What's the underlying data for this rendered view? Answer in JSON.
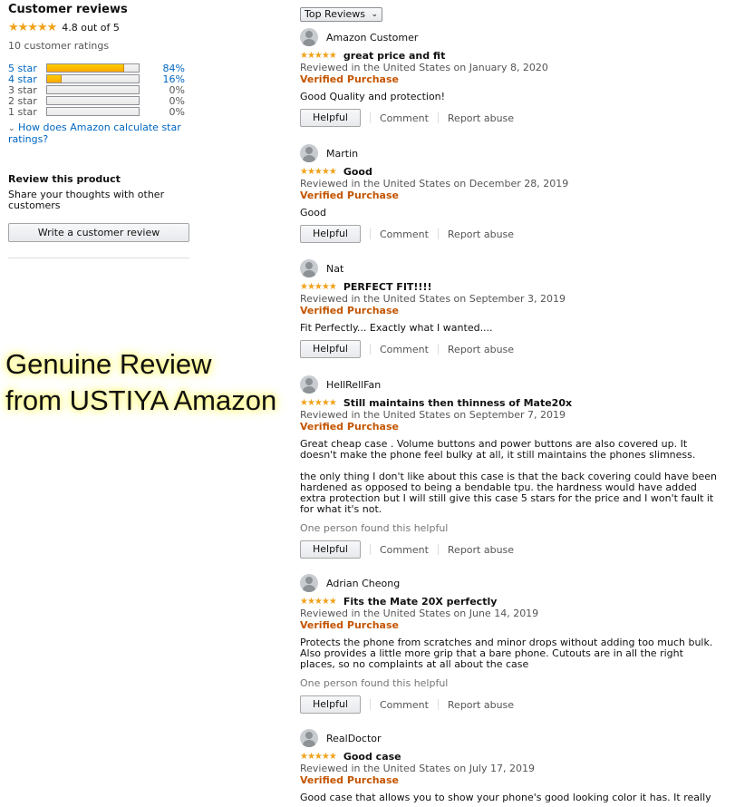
{
  "summary": {
    "title": "Customer reviews",
    "stars": "★★★★★",
    "average": "4.8 out of 5",
    "count": "10 customer ratings",
    "histogram": [
      {
        "label": "5 star",
        "percent": "84%",
        "fill": 0.84
      },
      {
        "label": "4 star",
        "percent": "16%",
        "fill": 0.16
      },
      {
        "label": "3 star",
        "percent": "0%",
        "fill": 0
      },
      {
        "label": "2 star",
        "percent": "0%",
        "fill": 0
      },
      {
        "label": "1 star",
        "percent": "0%",
        "fill": 0
      }
    ],
    "calc_link": "How does Amazon calculate star ratings?",
    "review_heading": "Review this product",
    "share_text": "Share your thoughts with other customers",
    "write_button": "Write a customer review"
  },
  "watermark": {
    "line1": "Genuine Review",
    "line2": "from USTIYA Amazon"
  },
  "sort": {
    "selected": "Top Reviews"
  },
  "actions": {
    "helpful": "Helpful",
    "comment": "Comment",
    "report": "Report abuse"
  },
  "reviews": [
    {
      "author": "Amazon Customer",
      "stars": "★★★★★",
      "title": "great price and fit",
      "date": "Reviewed in the United States on January 8, 2020",
      "verified": "Verified Purchase",
      "body": [
        "Good Quality and protection!"
      ],
      "helpful_text": ""
    },
    {
      "author": "Martin",
      "stars": "★★★★★",
      "title": "Good",
      "date": "Reviewed in the United States on December 28, 2019",
      "verified": "Verified Purchase",
      "body": [
        "Good"
      ],
      "helpful_text": ""
    },
    {
      "author": "Nat",
      "stars": "★★★★★",
      "title": "PERFECT FIT!!!!",
      "date": "Reviewed in the United States on September 3, 2019",
      "verified": "Verified Purchase",
      "body": [
        "Fit Perfectly... Exactly what I wanted...."
      ],
      "helpful_text": ""
    },
    {
      "author": "HellRellFan",
      "stars": "★★★★★",
      "title": "Still maintains then thinness of Mate20x",
      "date": "Reviewed in the United States on September 7, 2019",
      "verified": "Verified Purchase",
      "body": [
        "Great cheap case . Volume buttons and power buttons are also covered up. It doesn't make the phone feel bulky at all, it still maintains the phones slimness.",
        "the only thing I don't like about this case is that the back covering could have been hardened as opposed to being a bendable tpu. the hardness would have added extra protection but I will still give this case 5 stars for the price and I won't fault it for what it's not."
      ],
      "helpful_text": "One person found this helpful"
    },
    {
      "author": "Adrian Cheong",
      "stars": "★★★★★",
      "title": "Fits the Mate 20X perfectly",
      "date": "Reviewed in the United States on June 14, 2019",
      "verified": "Verified Purchase",
      "body": [
        "Protects the phone from scratches and minor drops without adding too much bulk. Also provides a little more grip that a bare phone. Cutouts are in all the right places, so no complaints at all about the case"
      ],
      "helpful_text": "One person found this helpful"
    },
    {
      "author": "RealDoctor",
      "stars": "★★★★★",
      "title": "Good case",
      "date": "Reviewed in the United States on July 17, 2019",
      "verified": "Verified Purchase",
      "body": [
        "Good case that allows you to show your phone's good looking color it has. It really"
      ],
      "helpful_text": ""
    }
  ]
}
